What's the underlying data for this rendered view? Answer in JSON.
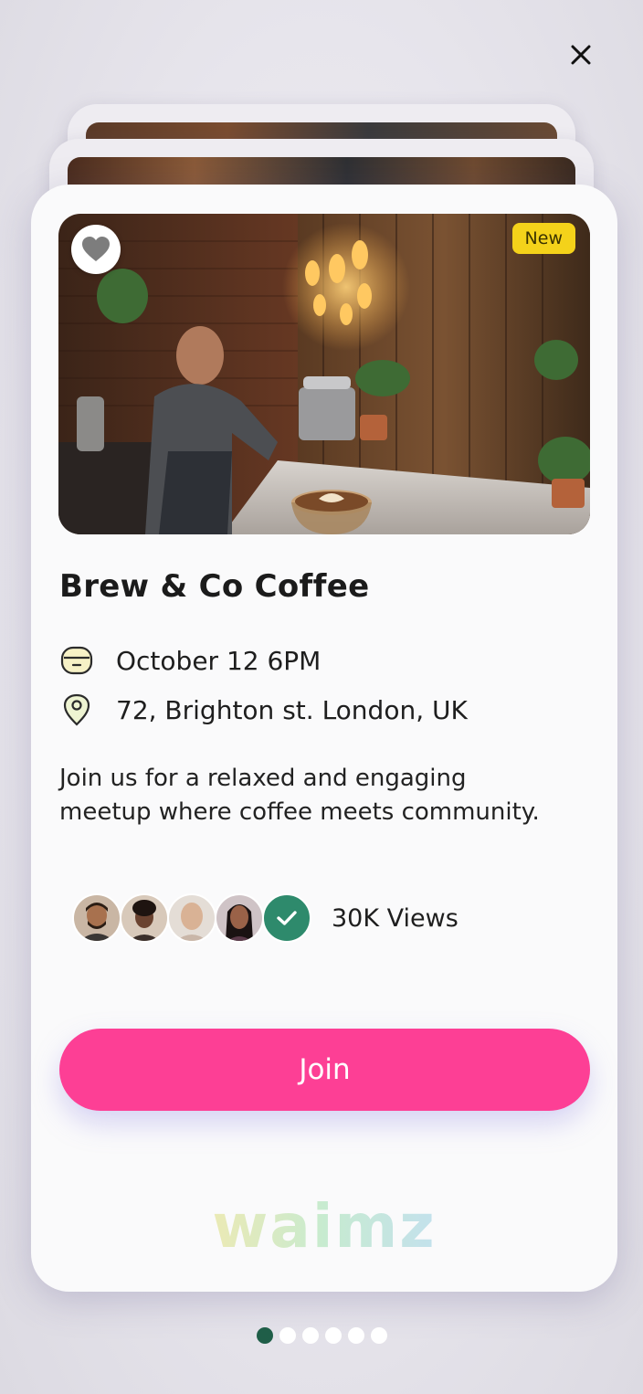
{
  "header": {
    "close_icon": "close-icon"
  },
  "event": {
    "badge": "New",
    "title": "Brew & Co Coffee",
    "date": "October 12 6PM",
    "location": "72, Brighton st. London, UK",
    "description": "Join us for a relaxed and engaging meetup where coffee meets community.",
    "views": "30K Views",
    "join_label": "Join"
  },
  "branding": {
    "watermark": "waimz"
  },
  "pagination": {
    "total": 6,
    "active_index": 0
  },
  "colors": {
    "accent": "#fd3f95",
    "badge": "#f4d21a",
    "check": "#2e8a6c",
    "active_dot": "#1f5e48"
  }
}
